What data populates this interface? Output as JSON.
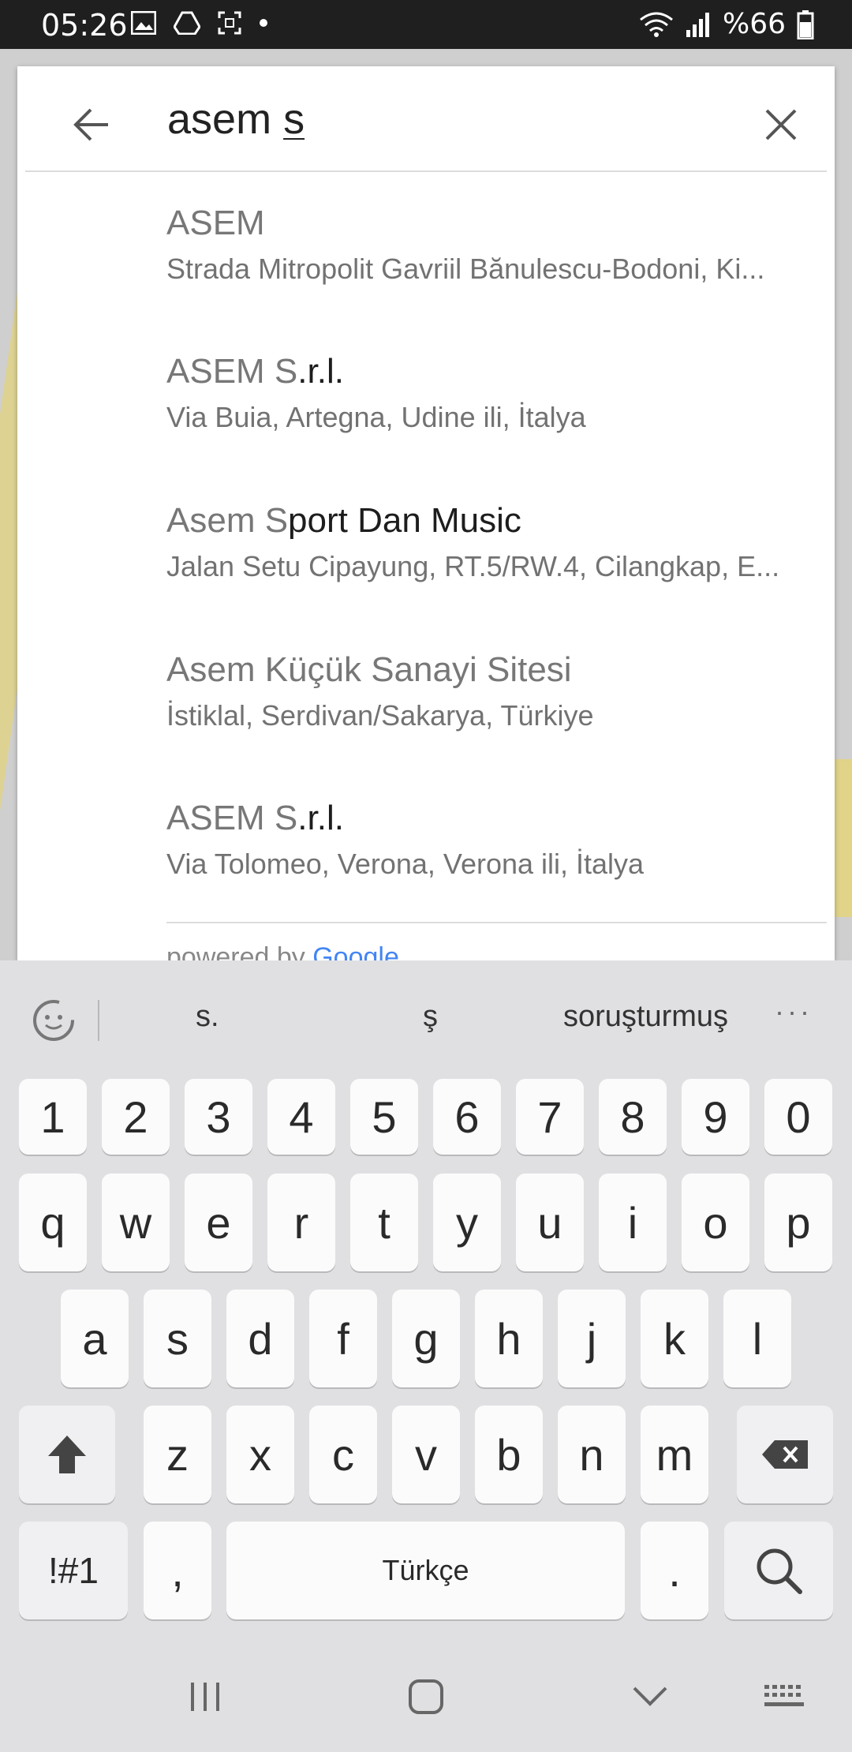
{
  "status_bar": {
    "time": "05:26",
    "battery": "%66",
    "icons_left": [
      "image-icon",
      "drive-icon",
      "screenshot-icon",
      "dot-icon"
    ],
    "icons_right": [
      "wifi-icon",
      "signal-icon",
      "battery-icon"
    ]
  },
  "search": {
    "query_prefix": "asem ",
    "query_underlined": "s"
  },
  "results": [
    {
      "title_match": "ASEM",
      "title_rest": "",
      "address": "Strada Mitropolit Gavriil Bănulescu-Bodoni, Ki..."
    },
    {
      "title_match": "ASEM S",
      "title_rest": ".r.l.",
      "address": "Via Buia, Artegna, Udine ili, İtalya"
    },
    {
      "title_match": "Asem S",
      "title_rest": "port Dan Music",
      "address": "Jalan Setu Cipayung, RT.5/RW.4, Cilangkap, E..."
    },
    {
      "title_match": "Asem Küçük Sanayi Sitesi",
      "title_rest": "",
      "address": "İstiklal, Serdivan/Sakarya, Türkiye"
    },
    {
      "title_match": "ASEM S",
      "title_rest": ".r.l.",
      "address": "Via Tolomeo, Verona, Verona ili, İtalya"
    }
  ],
  "powered_by": {
    "prefix": "powered by ",
    "brand": "Google"
  },
  "keyboard": {
    "suggestions": [
      "s.",
      "ş",
      "soruşturmuş"
    ],
    "more": "···",
    "row_numbers": [
      "1",
      "2",
      "3",
      "4",
      "5",
      "6",
      "7",
      "8",
      "9",
      "0"
    ],
    "row1": [
      "q",
      "w",
      "e",
      "r",
      "t",
      "y",
      "u",
      "i",
      "o",
      "p"
    ],
    "row2": [
      "a",
      "s",
      "d",
      "f",
      "g",
      "h",
      "j",
      "k",
      "l"
    ],
    "row3": [
      "z",
      "x",
      "c",
      "v",
      "b",
      "n",
      "m"
    ],
    "symbols_label": "!#1",
    "comma_label": ",",
    "space_label": "Türkçe",
    "period_label": "."
  },
  "colors": {
    "accent_google_blue": "#4285F4",
    "text_primary": "#1d1d1d",
    "text_secondary": "#727272"
  }
}
